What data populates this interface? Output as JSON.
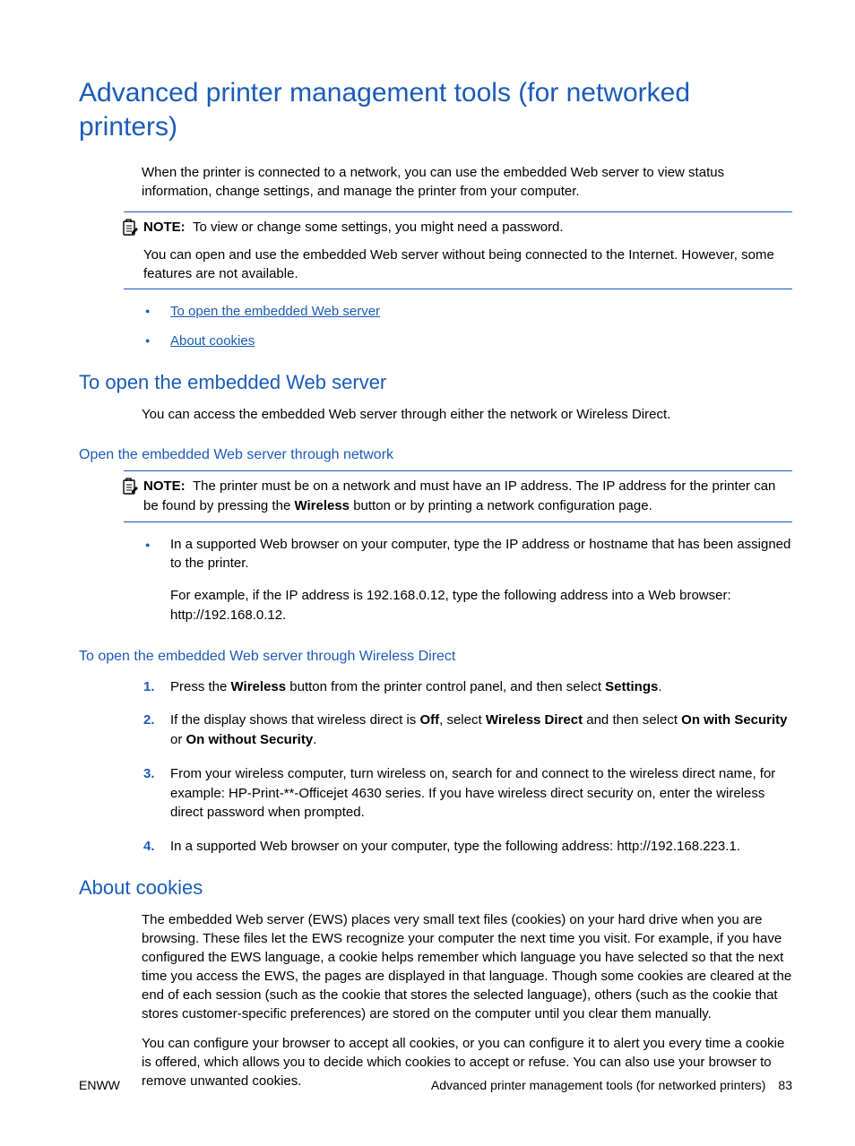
{
  "title": "Advanced printer management tools (for networked printers)",
  "intro": "When the printer is connected to a network, you can use the embedded Web server to view status information, change settings, and manage the printer from your computer.",
  "note1": {
    "label": "NOTE:",
    "text": "To view or change some settings, you might need a password.",
    "after": "You can open and use the embedded Web server without being connected to the Internet. However, some features are not available."
  },
  "links": [
    "To open the embedded Web server",
    "About cookies"
  ],
  "section1": {
    "heading": "To open the embedded Web server",
    "intro": "You can access the embedded Web server through either the network or Wireless Direct.",
    "sub1": {
      "heading": "Open the embedded Web server through network",
      "note": {
        "label": "NOTE:",
        "pre": "The printer must be on a network and must have an IP address. The IP address for the printer can be found by pressing the ",
        "bold": "Wireless",
        "post": " button or by printing a network configuration page."
      },
      "bullet": {
        "main": "In a supported Web browser on your computer, type the IP address or hostname that has been assigned to the printer.",
        "example": "For example, if the IP address is 192.168.0.12, type the following address into a Web browser: http://192.168.0.12."
      }
    },
    "sub2": {
      "heading": "To open the embedded Web server through Wireless Direct",
      "steps": {
        "s1_a": "Press the ",
        "s1_b1": "Wireless",
        "s1_c": " button from the printer control panel, and then select ",
        "s1_b2": "Settings",
        "s1_d": ".",
        "s2_a": "If the display shows that wireless direct is ",
        "s2_b1": "Off",
        "s2_c": ", select ",
        "s2_b2": "Wireless Direct",
        "s2_d": " and then select ",
        "s2_b3": "On with Security",
        "s2_e": " or ",
        "s2_b4": "On without Security",
        "s2_f": ".",
        "s3": "From your wireless computer, turn wireless on, search for and connect to the wireless direct name, for example: HP-Print-**-Officejet 4630 series. If you have wireless direct security on, enter the wireless direct password when prompted.",
        "s4": "In a supported Web browser on your computer, type the following address: http://192.168.223.1."
      }
    }
  },
  "section2": {
    "heading": "About cookies",
    "p1": "The embedded Web server (EWS) places very small text files (cookies) on your hard drive when you are browsing. These files let the EWS recognize your computer the next time you visit. For example, if you have configured the EWS language, a cookie helps remember which language you have selected so that the next time you access the EWS, the pages are displayed in that language. Though some cookies are cleared at the end of each session (such as the cookie that stores the selected language), others (such as the cookie that stores customer-specific preferences) are stored on the computer until you clear them manually.",
    "p2": "You can configure your browser to accept all cookies, or you can configure it to alert you every time a cookie is offered, which allows you to decide which cookies to accept or refuse. You can also use your browser to remove unwanted cookies."
  },
  "footer": {
    "left": "ENWW",
    "right": "Advanced printer management tools (for networked printers)",
    "page": "83"
  }
}
